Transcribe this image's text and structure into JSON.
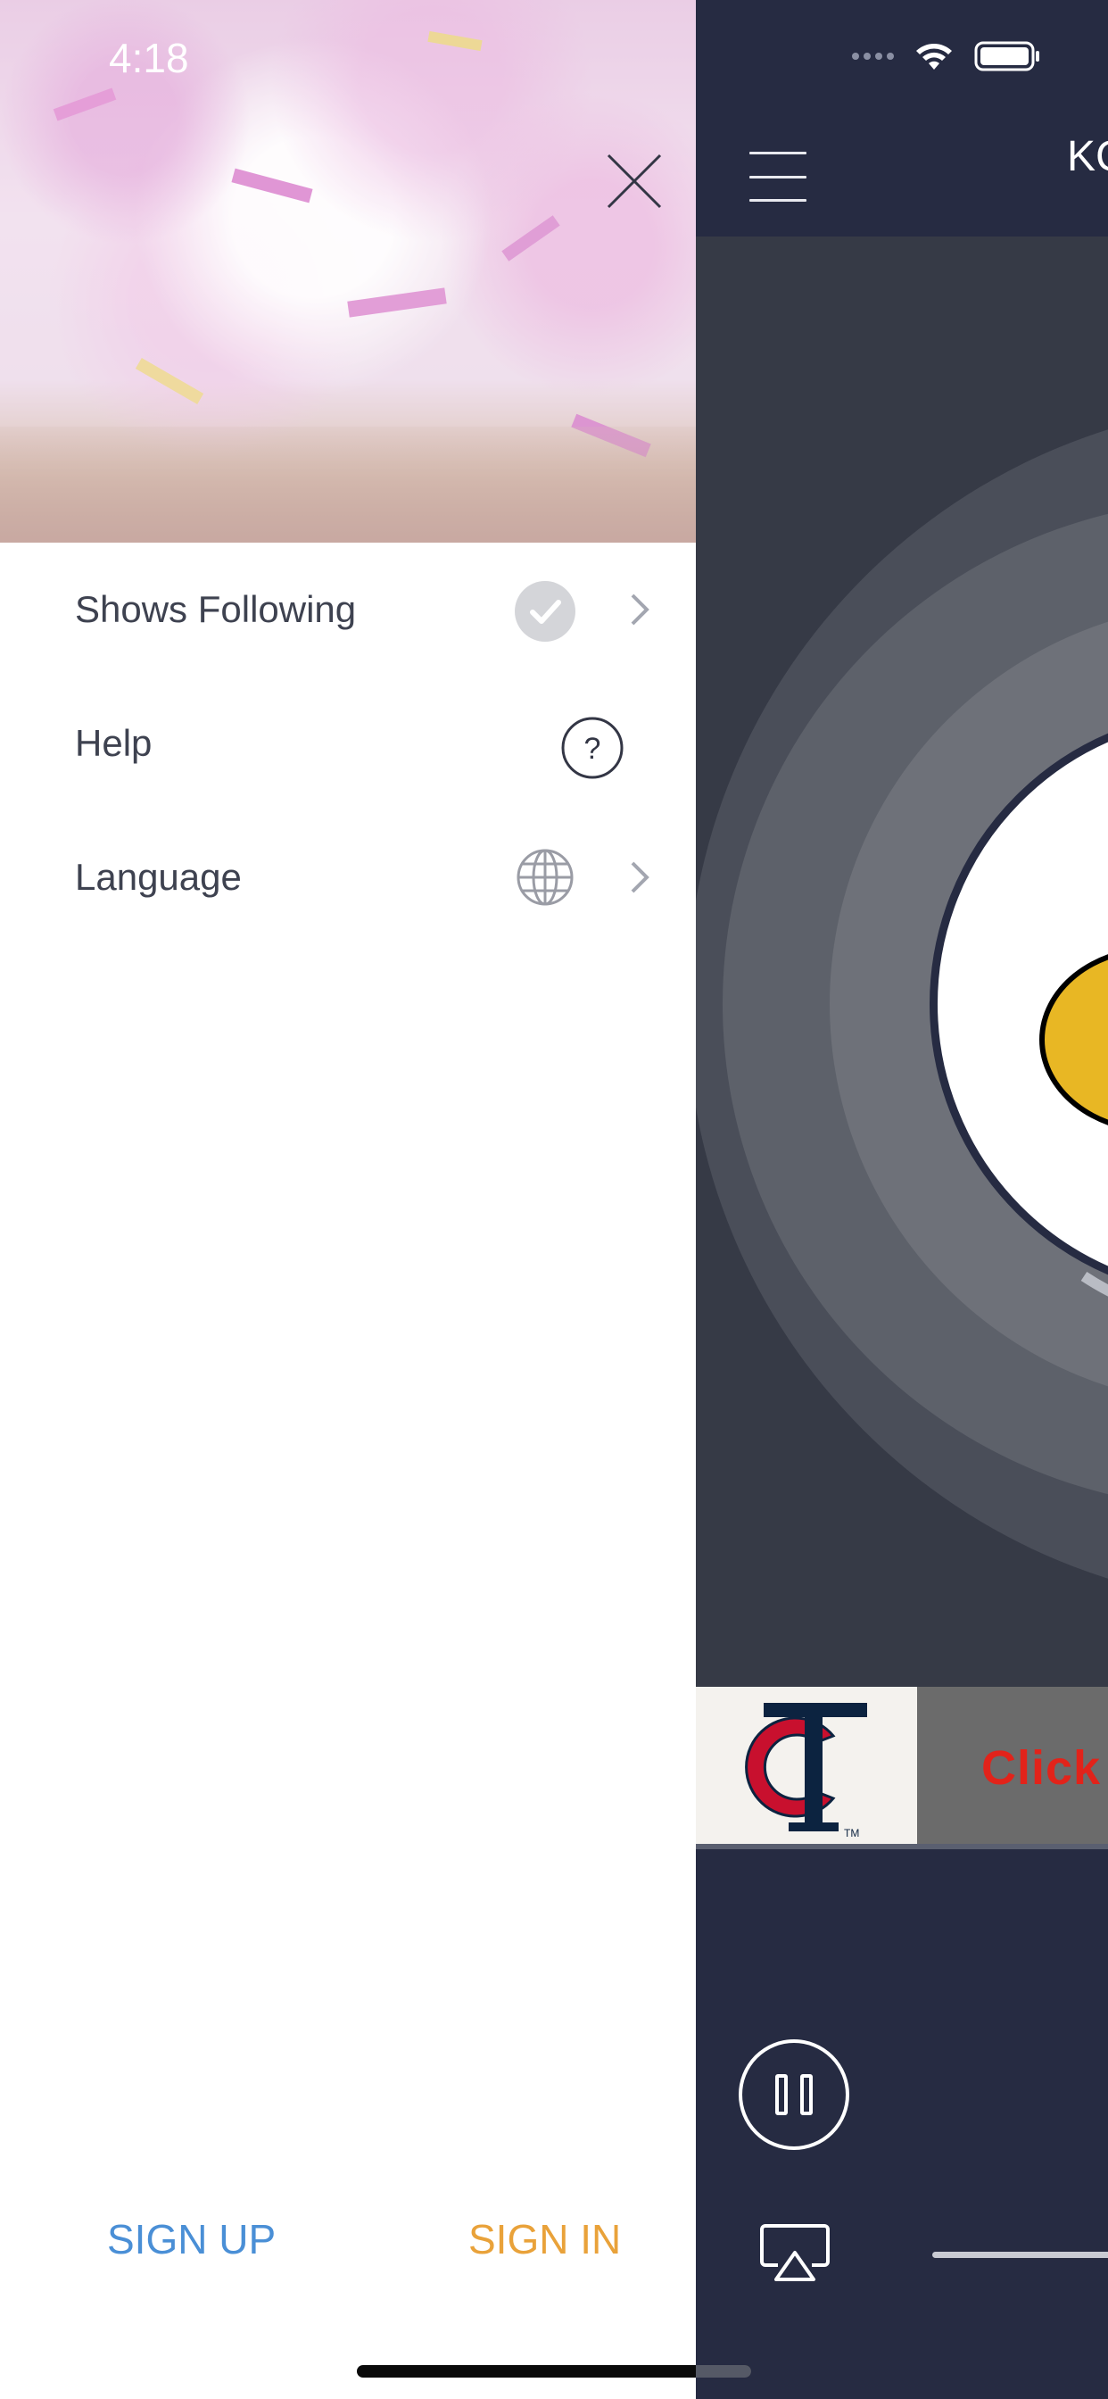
{
  "status_bar": {
    "time": "4:18"
  },
  "drawer": {
    "menu_items": [
      {
        "label": "Shows Following",
        "icon": "check-circle-icon",
        "has_chevron": true
      },
      {
        "label": "Help",
        "icon": "question-circle-icon",
        "has_chevron": false
      },
      {
        "label": "Language",
        "icon": "globe-icon",
        "has_chevron": true
      }
    ],
    "sign_up_label": "SIGN UP",
    "sign_in_label": "SIGN IN"
  },
  "player": {
    "station_title": "KC",
    "ad_text": "Click",
    "ad_logo": "twins-tc-logo"
  },
  "colors": {
    "sign_up": "#4a8fd6",
    "sign_in": "#e9a23a",
    "player_bg": "#262b42",
    "ad_text": "#e2231a"
  }
}
